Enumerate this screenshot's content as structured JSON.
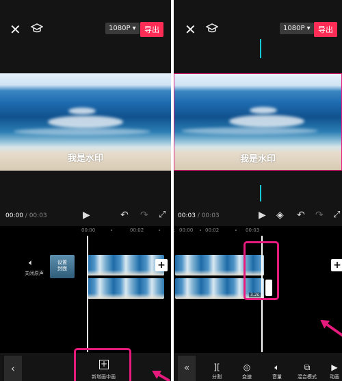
{
  "left": {
    "resolution": "1080P ▾",
    "export_label": "导出",
    "watermark": "我是水印",
    "time_current": "00:00",
    "time_sep": " / ",
    "time_total": "00:03",
    "ruler": [
      "00:00",
      "00:02"
    ],
    "mute_label": "关闭原声",
    "cover_label": "设置\n封面",
    "add_text_label": "新增画中画"
  },
  "right": {
    "resolution": "1080P ▾",
    "export_label": "导出",
    "watermark": "我是水印",
    "time_current": "00:03",
    "time_sep": " / ",
    "time_total": "00:03",
    "ruler": [
      "00:00",
      "00:02",
      "00:03"
    ],
    "clip_duration": "3.2s",
    "toolbar": [
      {
        "label": "分割",
        "icon": "split-icon"
      },
      {
        "label": "变速",
        "icon": "speed-icon"
      },
      {
        "label": "音量",
        "icon": "volume-icon"
      },
      {
        "label": "混合模式",
        "icon": "blend-icon"
      },
      {
        "label": "动画",
        "icon": "animation-icon"
      }
    ]
  },
  "colors": {
    "accent": "#ff2d55",
    "highlight": "#e6197c",
    "background": "#141414"
  }
}
